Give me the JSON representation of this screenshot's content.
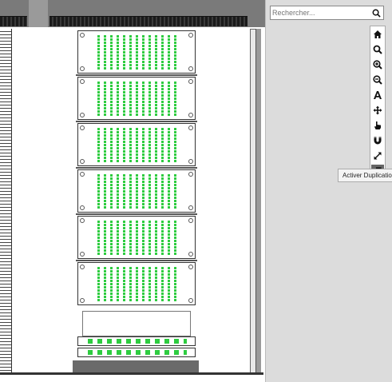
{
  "search": {
    "placeholder": "Rechercher..."
  },
  "toolbar": {
    "tools": [
      {
        "name": "home",
        "icon": "home-icon"
      },
      {
        "name": "search",
        "icon": "search-icon"
      },
      {
        "name": "zoom-in",
        "icon": "zoom-in-icon"
      },
      {
        "name": "zoom-out",
        "icon": "zoom-out-icon"
      },
      {
        "name": "text",
        "icon": "text-icon"
      },
      {
        "name": "move",
        "icon": "move-icon"
      },
      {
        "name": "pointer",
        "icon": "pointer-hand-icon"
      },
      {
        "name": "magnet",
        "icon": "magnet-icon"
      },
      {
        "name": "resize",
        "icon": "resize-icon"
      },
      {
        "name": "duplicate",
        "icon": "duplicate-icon",
        "active": true
      }
    ],
    "tooltip": "Activer Duplication"
  },
  "colors": {
    "port_green": "#2ecc40",
    "sidebar_bg": "#dcdcdc",
    "active_tool": "#666666"
  }
}
